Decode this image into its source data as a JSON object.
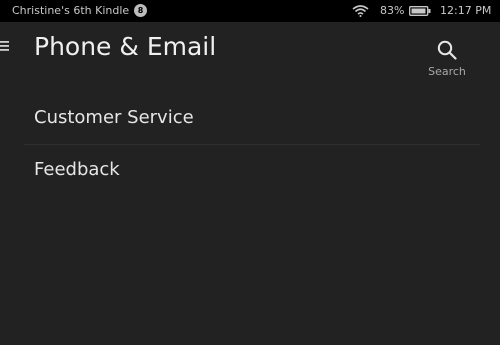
{
  "status_bar": {
    "device_name": "Christine's 6th Kindle",
    "notification_count": "8",
    "battery_percent": "83%",
    "time": "12:17 PM",
    "icons": [
      "wifi-icon",
      "battery-icon"
    ]
  },
  "header": {
    "title": "Phone & Email",
    "menu_icon": "hamburger-menu-icon",
    "search_label": "Search",
    "search_icon": "search-icon"
  },
  "list": {
    "items": [
      {
        "label": "Customer Service"
      },
      {
        "label": "Feedback"
      }
    ]
  },
  "colors": {
    "background": "#222222",
    "status_bar": "#000000",
    "text_primary": "#e8e8e8",
    "text_secondary": "#a8a8a8",
    "divider": "#2f2f2f"
  }
}
